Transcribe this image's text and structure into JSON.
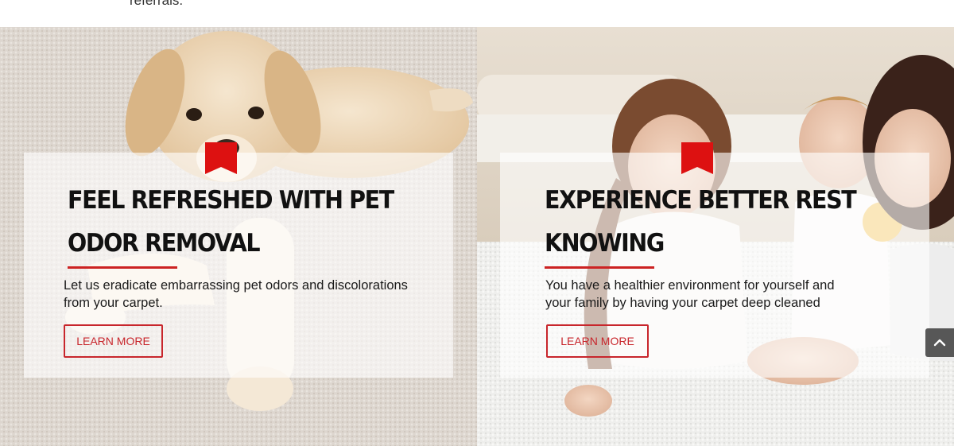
{
  "top": {
    "partial_text": "referrals."
  },
  "panels": [
    {
      "title": "FEEL REFRESHED WITH PET ODOR REMOVAL",
      "description": "Let us eradicate embarrassing pet odors and discolorations from your carpet.",
      "button_label": "LEARN MORE",
      "image_subject": "puppy-on-carpet"
    },
    {
      "title": "EXPERIENCE BETTER REST KNOWING",
      "description": "You have a healthier environment for yourself and your family by having your carpet deep cleaned",
      "button_label": "LEARN MORE",
      "image_subject": "family-on-carpet"
    }
  ],
  "colors": {
    "accent": "#cc2222",
    "button_text": "#c8262c",
    "title": "#111111",
    "card_overlay": "rgba(255,255,255,0.62)"
  },
  "icons": {
    "ribbon": "bookmark-ribbon-icon",
    "scroll_top": "chevron-up-icon"
  }
}
